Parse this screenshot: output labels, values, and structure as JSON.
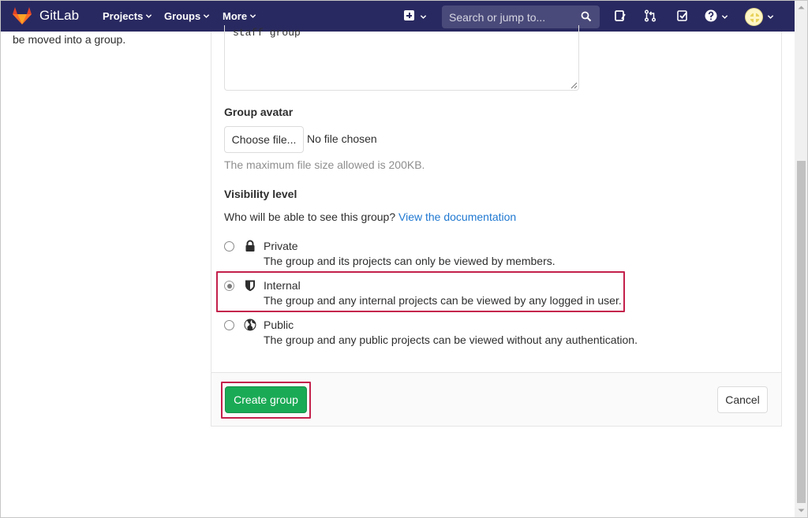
{
  "navbar": {
    "brand": "GitLab",
    "links": [
      {
        "label": "Projects"
      },
      {
        "label": "Groups"
      },
      {
        "label": "More"
      }
    ],
    "search_placeholder": "Search or jump to...",
    "background": "#292961"
  },
  "sidebar": {
    "text": "be moved into a group."
  },
  "form": {
    "description_value": "staff group",
    "avatar_label": "Group avatar",
    "choose_file_label": "Choose file...",
    "no_file_text": "No file chosen",
    "max_size_help": "The maximum file size allowed is 200KB.",
    "visibility_label": "Visibility level",
    "visibility_question": "Who will be able to see this group?",
    "doc_link": "View the documentation",
    "options": [
      {
        "title": "Private",
        "desc": "The group and its projects can only be viewed by members.",
        "icon": "lock-icon",
        "selected": false
      },
      {
        "title": "Internal",
        "desc": "The group and any internal projects can be viewed by any logged in user.",
        "icon": "shield-icon",
        "selected": true
      },
      {
        "title": "Public",
        "desc": "The group and any public projects can be viewed without any authentication.",
        "icon": "globe-icon",
        "selected": false
      }
    ],
    "create_label": "Create group",
    "cancel_label": "Cancel"
  },
  "colors": {
    "create_button": "#1aaa55",
    "highlight": "#c4204b",
    "link": "#1f78d1"
  }
}
